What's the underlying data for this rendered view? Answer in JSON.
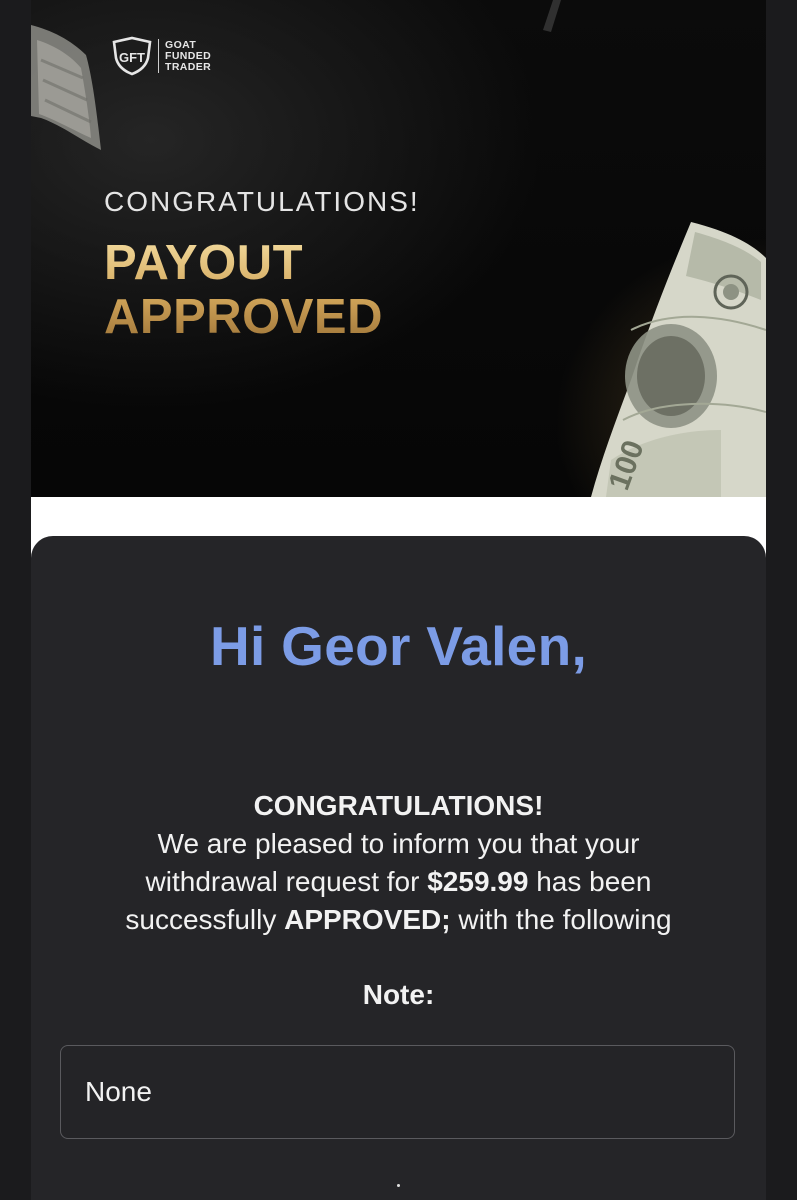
{
  "brand": {
    "logo_initials": "GFT",
    "logo_lines": [
      "GOAT",
      "FUNDED",
      "TRADER"
    ]
  },
  "banner": {
    "congrats": "CONGRATULATIONS!",
    "headline_line1": "PAYOUT",
    "headline_line2": "APPROVED"
  },
  "email": {
    "greeting": "Hi Geor Valen,",
    "congrats_heading": "CONGRATULATIONS!",
    "line1": "We are pleased to inform you that your",
    "line2_prefix": "withdrawal request for ",
    "amount": "$259.99",
    "line2_suffix": " has been",
    "line3_prefix": "successfully ",
    "status_word": "APPROVED;",
    "line3_suffix": " with the following",
    "note_label": "Note:",
    "note_value": "None"
  },
  "colors": {
    "greeting": "#7c9ce6",
    "card_bg": "#252528",
    "gold": "#d8b46a"
  }
}
